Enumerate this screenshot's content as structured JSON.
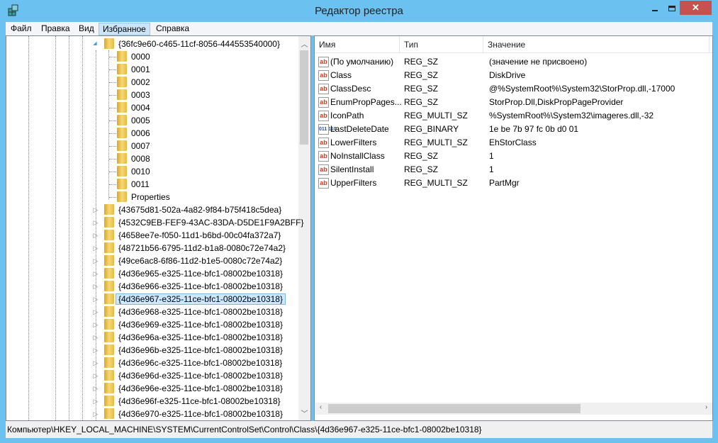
{
  "window": {
    "title": "Редактор реестра",
    "minimize": "–",
    "maximize": "☐",
    "close": "✕"
  },
  "menu": [
    "Файл",
    "Правка",
    "Вид",
    "Избранное",
    "Справка"
  ],
  "tree": {
    "parent": "{36fc9e60-c465-11cf-8056-444553540000}",
    "children": [
      "0000",
      "0001",
      "0002",
      "0003",
      "0004",
      "0005",
      "0006",
      "0007",
      "0008",
      "0010",
      "0011",
      "Properties"
    ],
    "siblings": [
      "{43675d81-502a-4a82-9f84-b75f418c5dea}",
      "{4532C9EB-FEF9-43AC-83DA-D5DE1F9A2BFF}",
      "{4658ee7e-f050-11d1-b6bd-00c04fa372a7}",
      "{48721b56-6795-11d2-b1a8-0080c72e74a2}",
      "{49ce6ac8-6f86-11d2-b1e5-0080c72e74a2}",
      "{4d36e965-e325-11ce-bfc1-08002be10318}",
      "{4d36e966-e325-11ce-bfc1-08002be10318}",
      "{4d36e967-e325-11ce-bfc1-08002be10318}",
      "{4d36e968-e325-11ce-bfc1-08002be10318}",
      "{4d36e969-e325-11ce-bfc1-08002be10318}",
      "{4d36e96a-e325-11ce-bfc1-08002be10318}",
      "{4d36e96b-e325-11ce-bfc1-08002be10318}",
      "{4d36e96c-e325-11ce-bfc1-08002be10318}",
      "{4d36e96d-e325-11ce-bfc1-08002be10318}",
      "{4d36e96e-e325-11ce-bfc1-08002be10318}",
      "{4d36e96f-e325-11ce-bfc1-08002be10318}",
      "{4d36e970-e325-11ce-bfc1-08002be10318}"
    ],
    "selected_index": 7
  },
  "list": {
    "headers": [
      "Имя",
      "Тип",
      "Значение"
    ],
    "rows": [
      {
        "name": "(По умолчанию)",
        "type": "REG_SZ",
        "value": "(значение не присвоено)",
        "icon": "ab"
      },
      {
        "name": "Class",
        "type": "REG_SZ",
        "value": "DiskDrive",
        "icon": "ab"
      },
      {
        "name": "ClassDesc",
        "type": "REG_SZ",
        "value": "@%SystemRoot%\\System32\\StorProp.dll,-17000",
        "icon": "ab"
      },
      {
        "name": "EnumPropPages...",
        "type": "REG_SZ",
        "value": "StorProp.Dll,DiskPropPageProvider",
        "icon": "ab"
      },
      {
        "name": "IconPath",
        "type": "REG_MULTI_SZ",
        "value": "%SystemRoot%\\System32\\imageres.dll,-32",
        "icon": "ab"
      },
      {
        "name": "LastDeleteDate",
        "type": "REG_BINARY",
        "value": "1e be 7b 97 fc 0b d0 01",
        "icon": "011 110"
      },
      {
        "name": "LowerFilters",
        "type": "REG_MULTI_SZ",
        "value": "EhStorClass",
        "icon": "ab"
      },
      {
        "name": "NoInstallClass",
        "type": "REG_SZ",
        "value": "1",
        "icon": "ab"
      },
      {
        "name": "SilentInstall",
        "type": "REG_SZ",
        "value": "1",
        "icon": "ab"
      },
      {
        "name": "UpperFilters",
        "type": "REG_MULTI_SZ",
        "value": "PartMgr",
        "icon": "ab"
      }
    ]
  },
  "status": "Компьютер\\HKEY_LOCAL_MACHINE\\SYSTEM\\CurrentControlSet\\Control\\Class\\{4d36e967-e325-11ce-bfc1-08002be10318}"
}
